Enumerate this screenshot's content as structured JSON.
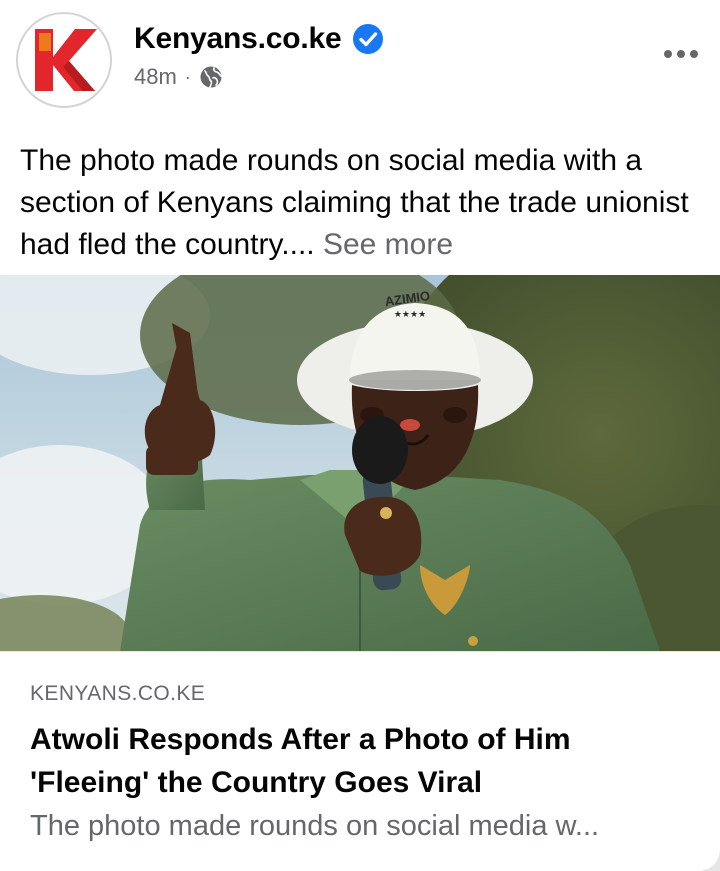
{
  "post": {
    "page_name": "Kenyans.co.ke",
    "time": "48m",
    "separator": "·",
    "audience_icon": "globe-icon",
    "verified_icon": "verified-badge-icon",
    "more_icon": "more-options-icon",
    "text": "The photo made rounds on social media with a section of Kenyans claiming that the trade unionist had fled the country....",
    "see_more": "See more"
  },
  "photo": {
    "hat_text": "AZIMIO",
    "hat_stars": "★★★★"
  },
  "link": {
    "domain": "KENYANS.CO.KE",
    "title": "Atwoli Responds After a Photo of Him 'Fleeing' the Country Goes Viral",
    "description": "The photo made rounds on social media w..."
  },
  "colors": {
    "logo_red": "#e3262b",
    "verified_blue": "#1877f2",
    "secondary_text": "#65676b",
    "shirt_green": "#5c7f58"
  }
}
